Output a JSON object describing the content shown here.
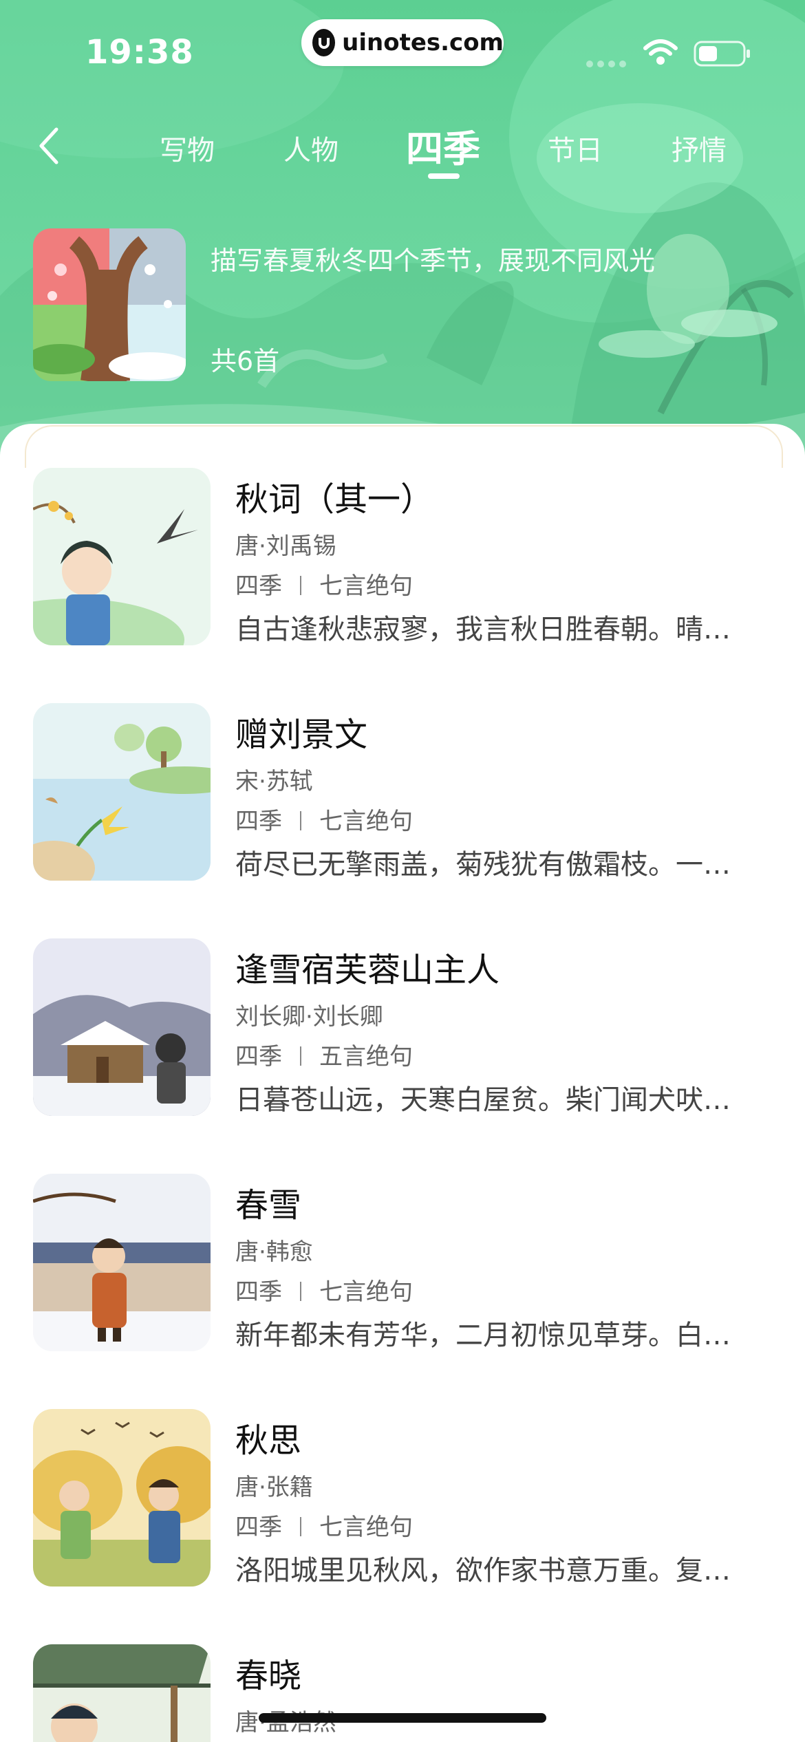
{
  "status": {
    "time": "19:38",
    "url": "uinotes.com"
  },
  "nav": {
    "tabs": [
      {
        "label": "",
        "active": false
      },
      {
        "label": "写物",
        "active": false
      },
      {
        "label": "人物",
        "active": false
      },
      {
        "label": "四季",
        "active": true
      },
      {
        "label": "节日",
        "active": false
      },
      {
        "label": "抒情",
        "active": false
      },
      {
        "label": "",
        "active": false
      }
    ]
  },
  "header": {
    "description": "描写春夏秋冬四个季节，展现不同风光",
    "count": "共6首"
  },
  "poems": [
    {
      "title": "秋词（其一）",
      "author": "唐·刘禹锡",
      "category": "四季",
      "form": "七言绝句",
      "excerpt": "自古逢秋悲寂寥，我言秋日胜春朝。晴…"
    },
    {
      "title": "赠刘景文",
      "author": "宋·苏轼",
      "category": "四季",
      "form": "七言绝句",
      "excerpt": "荷尽已无擎雨盖，菊残犹有傲霜枝。一…"
    },
    {
      "title": "逢雪宿芙蓉山主人",
      "author": "刘长卿·刘长卿",
      "category": "四季",
      "form": "五言绝句",
      "excerpt": "日暮苍山远，天寒白屋贫。柴门闻犬吠…"
    },
    {
      "title": "春雪",
      "author": "唐·韩愈",
      "category": "四季",
      "form": "七言绝句",
      "excerpt": "新年都未有芳华，二月初惊见草芽。白…"
    },
    {
      "title": "秋思",
      "author": "唐·张籍",
      "category": "四季",
      "form": "七言绝句",
      "excerpt": "洛阳城里见秋风，欲作家书意万重。复…"
    },
    {
      "title": "春晓",
      "author": "唐·孟浩然",
      "category": "",
      "form": "",
      "excerpt": ""
    }
  ]
}
